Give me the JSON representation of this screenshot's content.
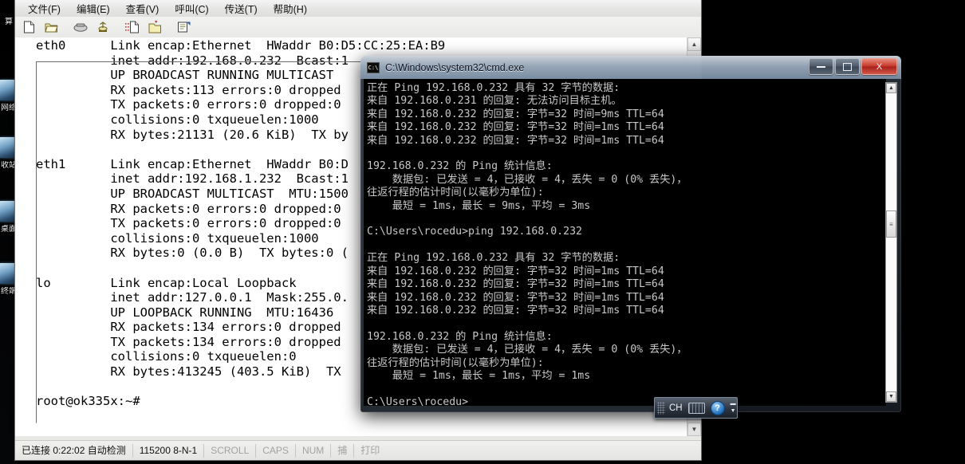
{
  "desktop": {
    "icons": [
      {
        "name": "network-icon",
        "label": "网络"
      },
      {
        "name": "computer-icon",
        "label": "收站"
      },
      {
        "name": "drive-icon",
        "label": "桌面"
      },
      {
        "name": "terminal-icon",
        "label": "终端"
      }
    ],
    "top_label": "算"
  },
  "terminal_window": {
    "menubar": [
      {
        "name": "menu-file",
        "label": "文件(F)"
      },
      {
        "name": "menu-edit",
        "label": "编辑(E)"
      },
      {
        "name": "menu-view",
        "label": "查看(V)"
      },
      {
        "name": "menu-call",
        "label": "呼叫(C)"
      },
      {
        "name": "menu-transfer",
        "label": "传送(T)"
      },
      {
        "name": "menu-help",
        "label": "帮助(H)"
      }
    ],
    "toolbar": [
      {
        "name": "new-session-icon",
        "glyph": "🗋",
        "title": "新建"
      },
      {
        "name": "open-session-icon",
        "glyph": "📂",
        "title": "打开"
      },
      {
        "name": "call-icon",
        "glyph": "☎",
        "title": "呼叫"
      },
      {
        "name": "hangup-icon",
        "glyph": "☏",
        "title": "挂断"
      },
      {
        "name": "send-file-icon",
        "glyph": "🗐",
        "title": "发送文件"
      },
      {
        "name": "receive-file-icon",
        "glyph": "🗂",
        "title": "接收文件"
      },
      {
        "name": "properties-icon",
        "glyph": "🗒",
        "title": "属性"
      }
    ],
    "console_text": "eth0      Link encap:Ethernet  HWaddr B0:D5:CC:25:EA:B9\n          inet addr:192.168.0.232  Bcast:1\n          UP BROADCAST RUNNING MULTICAST\n          RX packets:113 errors:0 dropped\n          TX packets:0 errors:0 dropped:0\n          collisions:0 txqueuelen:1000\n          RX bytes:21131 (20.6 KiB)  TX by\n\neth1      Link encap:Ethernet  HWaddr B0:D\n          inet addr:192.168.1.232  Bcast:1\n          UP BROADCAST MULTICAST  MTU:1500\n          RX packets:0 errors:0 dropped:0\n          TX packets:0 errors:0 dropped:0\n          collisions:0 txqueuelen:1000\n          RX bytes:0 (0.0 B)  TX bytes:0 (\n\nlo        Link encap:Local Loopback\n          inet addr:127.0.0.1  Mask:255.0.\n          UP LOOPBACK RUNNING  MTU:16436\n          RX packets:134 errors:0 dropped\n          TX packets:134 errors:0 dropped\n          collisions:0 txqueuelen:0\n          RX bytes:413245 (403.5 KiB)  TX\n\nroot@ok335x:~#",
    "scrollbar": {
      "up_glyph": "▲",
      "down_glyph": "▼"
    },
    "statusbar": [
      {
        "name": "status-connected",
        "label": "已连接 0:22:02 自动检测",
        "dim": false
      },
      {
        "name": "status-serial",
        "label": "115200 8-N-1",
        "dim": false
      },
      {
        "name": "status-scroll",
        "label": "SCROLL",
        "dim": true
      },
      {
        "name": "status-caps",
        "label": "CAPS",
        "dim": true
      },
      {
        "name": "status-num",
        "label": "NUM",
        "dim": true
      },
      {
        "name": "status-capture",
        "label": "捕",
        "dim": true
      },
      {
        "name": "status-print",
        "label": "打印",
        "dim": true
      }
    ]
  },
  "cmd_window": {
    "title": "C:\\Windows\\system32\\cmd.exe",
    "icon_label": "C:\\",
    "buttons": {
      "minimize": {
        "name": "minimize-button",
        "label": "—"
      },
      "maximize": {
        "name": "maximize-button",
        "label": "□"
      },
      "close": {
        "name": "close-button",
        "label": "X"
      }
    },
    "console_text": "正在 Ping 192.168.0.232 具有 32 字节的数据:\n来自 192.168.0.231 的回复: 无法访问目标主机。\n来自 192.168.0.232 的回复: 字节=32 时间=9ms TTL=64\n来自 192.168.0.232 的回复: 字节=32 时间=1ms TTL=64\n来自 192.168.0.232 的回复: 字节=32 时间=1ms TTL=64\n\n192.168.0.232 的 Ping 统计信息:\n    数据包: 已发送 = 4，已接收 = 4，丢失 = 0 (0% 丢失)，\n往返行程的估计时间(以毫秒为单位):\n    最短 = 1ms，最长 = 9ms，平均 = 3ms\n\nC:\\Users\\rocedu>ping 192.168.0.232\n\n正在 Ping 192.168.0.232 具有 32 字节的数据:\n来自 192.168.0.232 的回复: 字节=32 时间=1ms TTL=64\n来自 192.168.0.232 的回复: 字节=32 时间=1ms TTL=64\n来自 192.168.0.232 的回复: 字节=32 时间=1ms TTL=64\n来自 192.168.0.232 的回复: 字节=32 时间=1ms TTL=64\n\n192.168.0.232 的 Ping 统计信息:\n    数据包: 已发送 = 4，已接收 = 4，丢失 = 0 (0% 丢失)，\n往返行程的估计时间(以毫秒为单位):\n    最短 = 1ms，最长 = 1ms，平均 = 1ms\n\nC:\\Users\\rocedu>",
    "scrollbar": {
      "up_glyph": "▲",
      "down_glyph": "▼",
      "thumb_glyph": "≡"
    }
  },
  "ime_bar": {
    "language": "CH",
    "keyboard_icon": "keyboard-icon",
    "help_label": "?",
    "chevron_up": "▬",
    "chevron_down": "▼"
  },
  "colors": {
    "accent_close": "#c6372a",
    "terminal_bg": "#ffffff",
    "console_bg": "#000000",
    "console_fg": "#c8c8c8"
  }
}
